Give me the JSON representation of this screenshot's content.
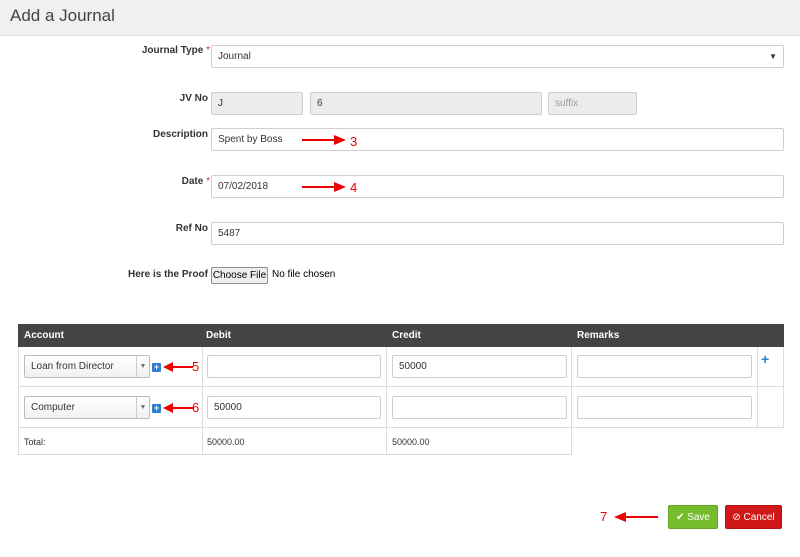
{
  "header": {
    "title": "Add a Journal"
  },
  "form": {
    "journal_type": {
      "label": "Journal Type",
      "required_mark": "*",
      "value": "Journal"
    },
    "jv_no": {
      "label": "JV No",
      "prefix": "J",
      "number": "6",
      "suffix_placeholder": "suffix"
    },
    "description": {
      "label": "Description",
      "value": "Spent by Boss"
    },
    "date": {
      "label": "Date",
      "required_mark": "*",
      "value": "07/02/2018"
    },
    "ref_no": {
      "label": "Ref No",
      "value": "5487"
    },
    "proof": {
      "label": "Here is the Proof",
      "button_label": "Choose File",
      "status": "No file chosen"
    }
  },
  "table": {
    "headers": [
      "Account",
      "Debit",
      "Credit",
      "Remarks"
    ],
    "rows": [
      {
        "account": "Loan from Director",
        "debit": "",
        "credit": "50000",
        "remarks": ""
      },
      {
        "account": "Computer",
        "debit": "50000",
        "credit": "",
        "remarks": ""
      }
    ],
    "total_label": "Total:",
    "total_debit": "50000.00",
    "total_credit": "50000.00"
  },
  "annotations": {
    "a3": "3",
    "a4": "4",
    "a5": "5",
    "a6": "6",
    "a7": "7"
  },
  "actions": {
    "save_icon": "check-icon",
    "save_label": "Save",
    "cancel_icon": "ban-icon",
    "cancel_label": "Cancel"
  },
  "colors": {
    "save": "#76bd2d",
    "cancel": "#d01818",
    "table_header": "#444444",
    "annotation": "#ee0000",
    "accent": "#2a7fd4"
  }
}
